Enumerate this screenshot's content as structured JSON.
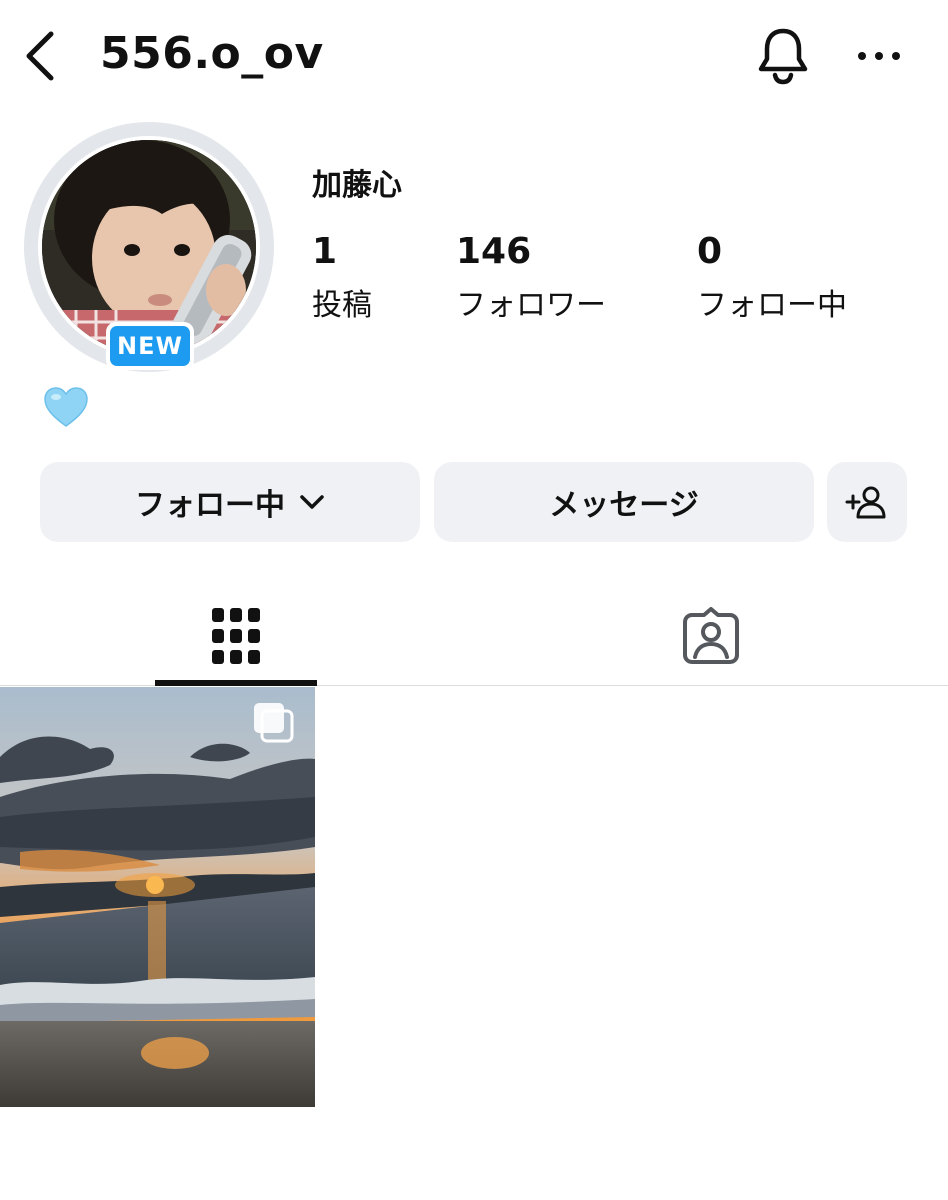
{
  "header": {
    "username": "556.o_ov"
  },
  "profile": {
    "display_name": "加藤心",
    "badge": "NEW",
    "bio_emoji": "light-blue-heart",
    "stats": [
      {
        "value": "1",
        "label": "投稿"
      },
      {
        "value": "146",
        "label": "フォロワー"
      },
      {
        "value": "0",
        "label": "フォロー中"
      }
    ]
  },
  "actions": {
    "following_label": "フォロー中",
    "message_label": "メッセージ"
  },
  "tabs": [
    {
      "icon": "grid-icon",
      "active": true
    },
    {
      "icon": "tagged-icon",
      "active": false
    }
  ],
  "colors": {
    "badge_blue": "#1d9bf0",
    "button_bg": "#eff1f4",
    "heart": "#8fd3f5"
  }
}
